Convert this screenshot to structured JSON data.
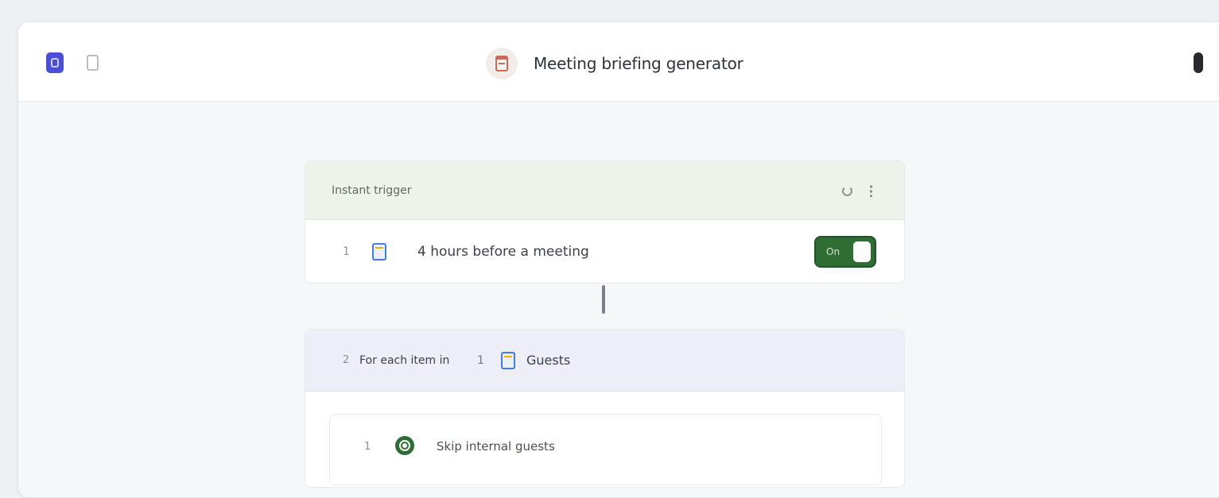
{
  "header": {
    "title": "Meeting briefing generator"
  },
  "trigger": {
    "section_label": "Instant trigger",
    "step_number": "1",
    "step_text": "4 hours before a meeting",
    "toggle_label": "On"
  },
  "loop": {
    "step_number": "2",
    "prefix_text": "For each item in",
    "ref_step_number": "1",
    "ref_field": "Guests"
  },
  "inner_step": {
    "step_number": "1",
    "text": "Skip internal guests"
  },
  "colors": {
    "accent_green": "#2f6d35",
    "trigger_header_bg": "#edf3ea",
    "loop_header_bg": "#eeeef8",
    "app_logo": "#4a4fd6"
  }
}
